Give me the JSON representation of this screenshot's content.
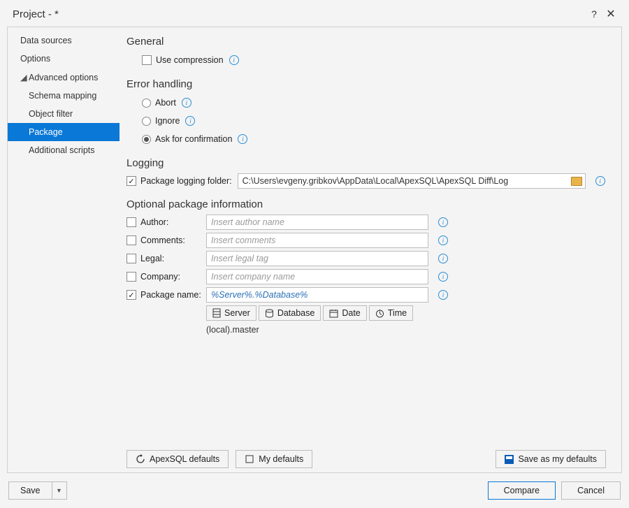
{
  "title": "Project  - *",
  "sidebar": {
    "items": [
      {
        "label": "Data sources"
      },
      {
        "label": "Options"
      },
      {
        "label": "Advanced options"
      },
      {
        "label": "Schema mapping"
      },
      {
        "label": "Object filter"
      },
      {
        "label": "Package"
      },
      {
        "label": "Additional scripts"
      }
    ]
  },
  "sections": {
    "general": {
      "heading": "General",
      "use_compression": "Use compression"
    },
    "error": {
      "heading": "Error handling",
      "abort": "Abort",
      "ignore": "Ignore",
      "ask": "Ask for confirmation"
    },
    "logging": {
      "heading": "Logging",
      "folder_label": "Package logging folder:",
      "folder_value": "C:\\Users\\evgeny.gribkov\\AppData\\Local\\ApexSQL\\ApexSQL Diff\\Log"
    },
    "optional": {
      "heading": "Optional package information",
      "author": {
        "label": "Author:",
        "placeholder": "Insert author name"
      },
      "comments": {
        "label": "Comments:",
        "placeholder": "Insert comments"
      },
      "legal": {
        "label": "Legal:",
        "placeholder": "Insert legal tag"
      },
      "company": {
        "label": "Company:",
        "placeholder": "Insert company name"
      },
      "pkgname": {
        "label": "Package name:",
        "value": "%Server%.%Database%"
      },
      "tokens": {
        "server": "Server",
        "database": "Database",
        "date": "Date",
        "time": "Time"
      },
      "preview": "(local).master"
    }
  },
  "buttons": {
    "apex_defaults": "ApexSQL defaults",
    "my_defaults": "My defaults",
    "save_my_defaults": "Save as my defaults",
    "save": "Save",
    "compare": "Compare",
    "cancel": "Cancel"
  }
}
